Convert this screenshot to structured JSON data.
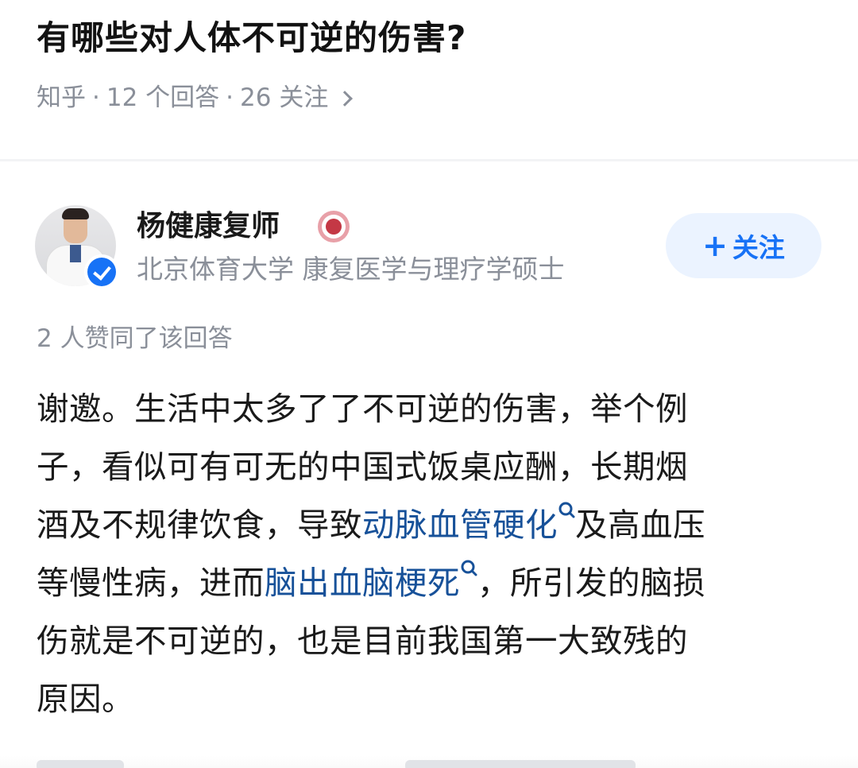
{
  "question": {
    "title": "有哪些对人体不可逆的伤害?",
    "source": "知乎",
    "separator": "·",
    "answer_count": "12 个回答",
    "follower_count": "26 关注"
  },
  "author": {
    "name": "杨健康复师",
    "description": "北京体育大学 康复医学与理疗学硕士",
    "follow_label": "关注",
    "follow_plus": "+"
  },
  "vote_summary": "2 人赞同了该回答",
  "answer": {
    "line1": "谢邀。生活中太多了了不可逆的伤害，举个例",
    "line2": "子，看似可有可无的中国式饭桌应酬，长期烟",
    "line3_a": "酒及不规律饮食，导致",
    "line3_link": "动脉血管硬化",
    "line3_b": "及高血压",
    "line4_a": "等慢性病，进而",
    "line4_link": "脑出血脑梗死",
    "line4_b": "，所引发的脑损",
    "line5": "伤就是不可逆的，也是目前我国第一大致残的",
    "line6": "原因。"
  },
  "colors": {
    "link": "#175199",
    "accent": "#1772f6",
    "meta_gray": "#8a8f99"
  },
  "icons": {
    "verified": "verified-check-icon",
    "honor": "honor-badge-icon",
    "keyword_search": "search-icon",
    "meta_arrow": "chevron-right-icon"
  }
}
